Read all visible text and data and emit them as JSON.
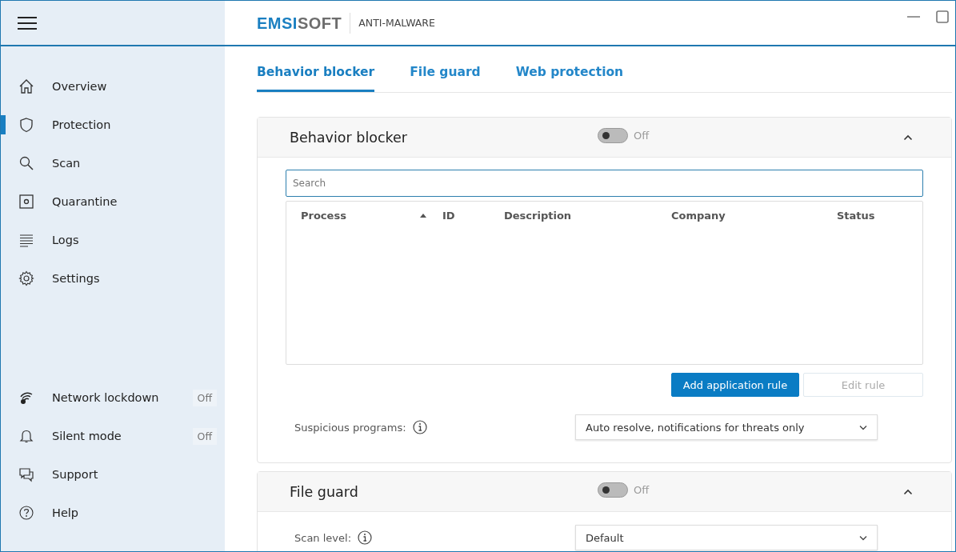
{
  "header": {
    "logo_primary": "EMSI",
    "logo_secondary": "SOFT",
    "product": "ANTI-MALWARE"
  },
  "sidebar": {
    "items": [
      {
        "kind": "overview",
        "label": "Overview",
        "selected": false
      },
      {
        "kind": "protection",
        "label": "Protection",
        "selected": true
      },
      {
        "kind": "scan",
        "label": "Scan",
        "selected": false
      },
      {
        "kind": "quarantine",
        "label": "Quarantine",
        "selected": false
      },
      {
        "kind": "logs",
        "label": "Logs",
        "selected": false
      },
      {
        "kind": "settings",
        "label": "Settings",
        "selected": false
      }
    ],
    "bottom_items": [
      {
        "kind": "network",
        "label": "Network lockdown",
        "badge": "Off"
      },
      {
        "kind": "silent",
        "label": "Silent mode",
        "badge": "Off"
      },
      {
        "kind": "support",
        "label": "Support"
      },
      {
        "kind": "help",
        "label": "Help"
      }
    ]
  },
  "tabs": [
    {
      "label": "Behavior blocker",
      "selected": true
    },
    {
      "label": "File guard",
      "selected": false
    },
    {
      "label": "Web protection",
      "selected": false
    }
  ],
  "sections": [
    {
      "title": "Behavior blocker",
      "on": false,
      "state": "Off",
      "expanded": true,
      "search": {
        "placeholder": "Search"
      },
      "table": {
        "columns": [
          {
            "label": "Process",
            "sorted": true
          },
          {
            "label": "ID",
            "sorted": false
          },
          {
            "label": "Description",
            "sorted": false
          },
          {
            "label": "Company",
            "sorted": false
          },
          {
            "label": "Status",
            "sorted": false
          }
        ]
      },
      "buttons": [
        {
          "label": "Add application rule",
          "disabled": false
        },
        {
          "label": "Edit rule",
          "disabled": true
        }
      ],
      "setting": {
        "label": "Suspicious programs:",
        "value": "Auto resolve, notifications for threats only"
      }
    },
    {
      "title": "File guard",
      "on": false,
      "state": "Off",
      "expanded": true,
      "setting": {
        "label": "Scan level:",
        "value": "Default"
      }
    }
  ]
}
